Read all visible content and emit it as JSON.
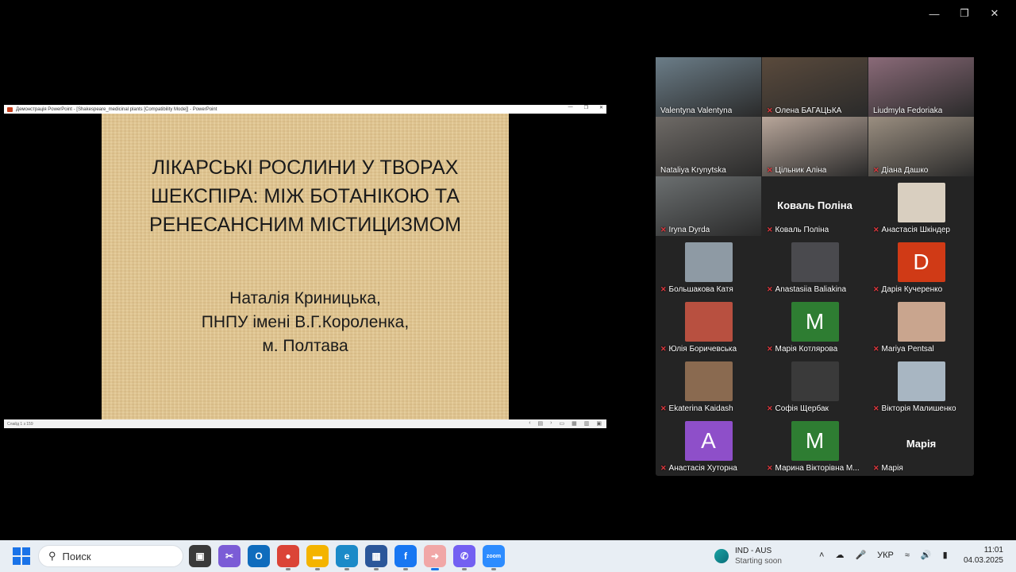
{
  "window_controls": {
    "minimize": "—",
    "restore": "❐",
    "close": "✕"
  },
  "ppt": {
    "title_bar": "Демонстрація PowerPoint - [Shakespeare_medicinal plants [Compatibility Mode]] - PowerPoint",
    "slide_title_lines": [
      "ЛІКАРСЬКІ РОСЛИНИ У ТВОРАХ",
      "ШЕКСПІРА: МІЖ БОТАНІКОЮ ТА",
      "РЕНЕСАНСНИМ МІСТИЦИЗМОМ"
    ],
    "author_lines": [
      "Наталія Криницька,",
      "ПНПУ імені В.Г.Короленка,",
      "м. Полтава"
    ],
    "status_left": "Слайд 1 з 159"
  },
  "participants": [
    {
      "name": "Valentyna Valentyna",
      "muted": false,
      "kind": "video",
      "color": "#6b7d88",
      "active": true
    },
    {
      "name": "Олена БАГАЦЬКА",
      "muted": true,
      "kind": "video",
      "color": "#5a4a3c"
    },
    {
      "name": "Liudmyla Fedoriaka",
      "muted": false,
      "kind": "video",
      "color": "#8a6a78"
    },
    {
      "name": "Nataliya Krynytska",
      "muted": false,
      "kind": "video",
      "color": "#6e6a66"
    },
    {
      "name": "Цільник Аліна",
      "muted": true,
      "kind": "video",
      "color": "#b8a69a"
    },
    {
      "name": "Діана Дашко",
      "muted": true,
      "kind": "video",
      "color": "#9a8e80"
    },
    {
      "name": "Iryna Dyrda",
      "muted": true,
      "kind": "video",
      "color": "#6b6f70"
    },
    {
      "name": "Коваль Поліна",
      "muted": true,
      "kind": "name",
      "big": "Коваль Поліна"
    },
    {
      "name": "Анастасія Шкіндер",
      "muted": true,
      "kind": "avatar",
      "color": "#d9cfc0"
    },
    {
      "name": "Большакова Катя",
      "muted": true,
      "kind": "avatar",
      "color": "#8e9aa4"
    },
    {
      "name": "Anastasiia Baliakina",
      "muted": true,
      "kind": "avatar",
      "color": "#4a4a4e"
    },
    {
      "name": "Дарія Кучеренко",
      "muted": true,
      "kind": "letter",
      "letter": "D",
      "color": "#d03a16"
    },
    {
      "name": "Юлія Боричевська",
      "muted": true,
      "kind": "avatar",
      "color": "#b85040"
    },
    {
      "name": "Марія Котлярова",
      "muted": true,
      "kind": "letter",
      "letter": "M",
      "color": "#2e7d32"
    },
    {
      "name": "Mariya Pentsal",
      "muted": true,
      "kind": "avatar",
      "color": "#c9a58e"
    },
    {
      "name": "Ekaterina Kaidash",
      "muted": true,
      "kind": "avatar",
      "color": "#8a6a50"
    },
    {
      "name": "Софія Щербак",
      "muted": true,
      "kind": "avatar",
      "color": "#3a3a3a"
    },
    {
      "name": "Вікторія Малишенко",
      "muted": true,
      "kind": "avatar",
      "color": "#a8b6c2"
    },
    {
      "name": "Анастасія Хуторна",
      "muted": true,
      "kind": "letter",
      "letter": "A",
      "color": "#8e4fc9"
    },
    {
      "name": "Марина  Вікторівна М...",
      "muted": true,
      "kind": "letter",
      "letter": "M",
      "color": "#2e7d32"
    },
    {
      "name": "Марія",
      "muted": true,
      "kind": "name",
      "big": "Марія"
    }
  ],
  "taskbar": {
    "search_placeholder": "Поиск",
    "apps": [
      {
        "icon": "task-view-icon",
        "glyph": "▣",
        "bg": "#3a3a3a"
      },
      {
        "icon": "snipping-tool-icon",
        "glyph": "✂",
        "bg": "#7b5cd6"
      },
      {
        "icon": "outlook-icon",
        "glyph": "O",
        "bg": "#0f6cbd"
      },
      {
        "icon": "chrome-icon",
        "glyph": "●",
        "bg": "#db4437"
      },
      {
        "icon": "file-explorer-icon",
        "glyph": "▬",
        "bg": "#f4b400"
      },
      {
        "icon": "edge-icon",
        "glyph": "e",
        "bg": "#1b8ac8"
      },
      {
        "icon": "microsoft-store-icon",
        "glyph": "▦",
        "bg": "#2b579a"
      },
      {
        "icon": "facebook-icon",
        "glyph": "f",
        "bg": "#1877f2"
      },
      {
        "icon": "green-arrow-app-icon",
        "glyph": "➜",
        "bg": "#f1a7a7"
      },
      {
        "icon": "viber-icon",
        "glyph": "✆",
        "bg": "#7360f2"
      },
      {
        "icon": "zoom-icon",
        "glyph": "zoom",
        "bg": "#2d8cff"
      }
    ],
    "weather_title": "IND - AUS",
    "weather_sub": "Starting soon",
    "lang": "УКР",
    "time": "11:01",
    "date": "04.03.2025"
  }
}
